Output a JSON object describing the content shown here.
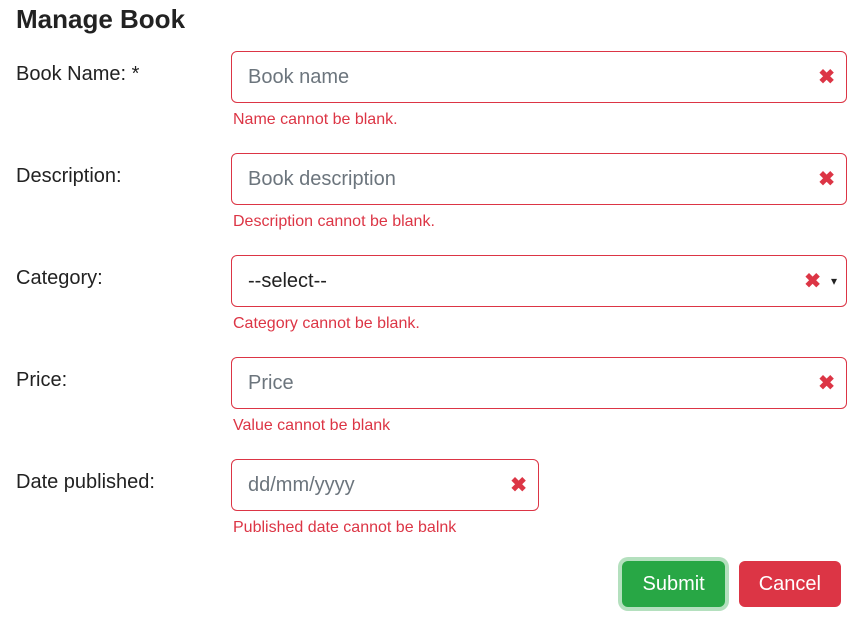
{
  "title": "Manage Book",
  "fields": {
    "name": {
      "label": "Book Name: *",
      "placeholder": "Book name",
      "value": "",
      "error": "Name cannot be blank."
    },
    "description": {
      "label": "Description:",
      "placeholder": "Book description",
      "value": "",
      "error": "Description cannot be blank."
    },
    "category": {
      "label": "Category:",
      "selected": "--select--",
      "error": "Category cannot be blank."
    },
    "price": {
      "label": "Price:",
      "placeholder": "Price",
      "value": "",
      "error": "Value cannot be blank"
    },
    "date": {
      "label": "Date published:",
      "placeholder": "dd/mm/yyyy",
      "value": "",
      "error": "Published date cannot be balnk"
    }
  },
  "buttons": {
    "submit": "Submit",
    "cancel": "Cancel"
  },
  "icons": {
    "clear": "✖",
    "caret": "▾"
  },
  "colors": {
    "error": "#dc3545",
    "submit": "#28a745",
    "cancel": "#dc3545"
  }
}
